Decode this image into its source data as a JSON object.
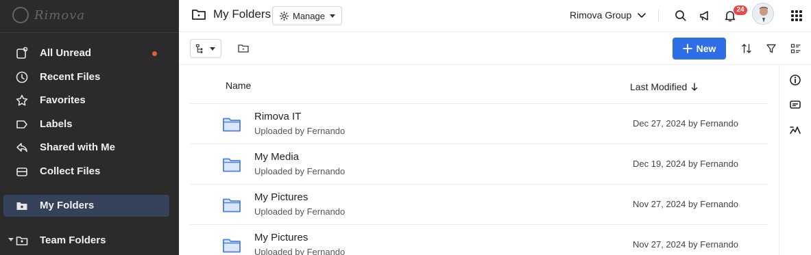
{
  "colors": {
    "sidebar_bg": "#2b2b2b",
    "sidebar_active_bg": "#364259",
    "accent": "#2e6ee6",
    "unread_dot": "#f05545",
    "badge": "#e74848",
    "folder": "#4a7fdc"
  },
  "sidebar": {
    "logo_text": "Rimova",
    "items": [
      {
        "label": "All Unread",
        "icon": "unread-icon",
        "unread": true
      },
      {
        "label": "Recent Files",
        "icon": "clock-icon"
      },
      {
        "label": "Favorites",
        "icon": "star-icon"
      },
      {
        "label": "Labels",
        "icon": "label-icon"
      },
      {
        "label": "Shared with Me",
        "icon": "share-icon"
      },
      {
        "label": "Collect Files",
        "icon": "collect-icon"
      },
      {
        "label": "My Folders",
        "icon": "folder-icon",
        "active": true
      },
      {
        "label": "Team Folders",
        "icon": "team-folder-icon",
        "collapsible": true
      }
    ]
  },
  "header": {
    "title": "My Folders",
    "manage_label": "Manage",
    "org_name": "Rimova Group",
    "notification_count": "24"
  },
  "toolbar": {
    "new_label": "New"
  },
  "table": {
    "columns": {
      "name": "Name",
      "last_modified": "Last Modified"
    },
    "rows": [
      {
        "name": "Rimova IT",
        "sub": "Uploaded by Fernando",
        "modified": "Dec 27, 2024 by Fernando"
      },
      {
        "name": "My Media",
        "sub": "Uploaded by Fernando",
        "modified": "Dec 19, 2024 by Fernando"
      },
      {
        "name": "My Pictures",
        "sub": "Uploaded by Fernando",
        "modified": "Nov 27, 2024 by Fernando"
      },
      {
        "name": "My Pictures",
        "sub": "Uploaded by Fernando",
        "modified": "Nov 27, 2024 by Fernando"
      }
    ]
  }
}
